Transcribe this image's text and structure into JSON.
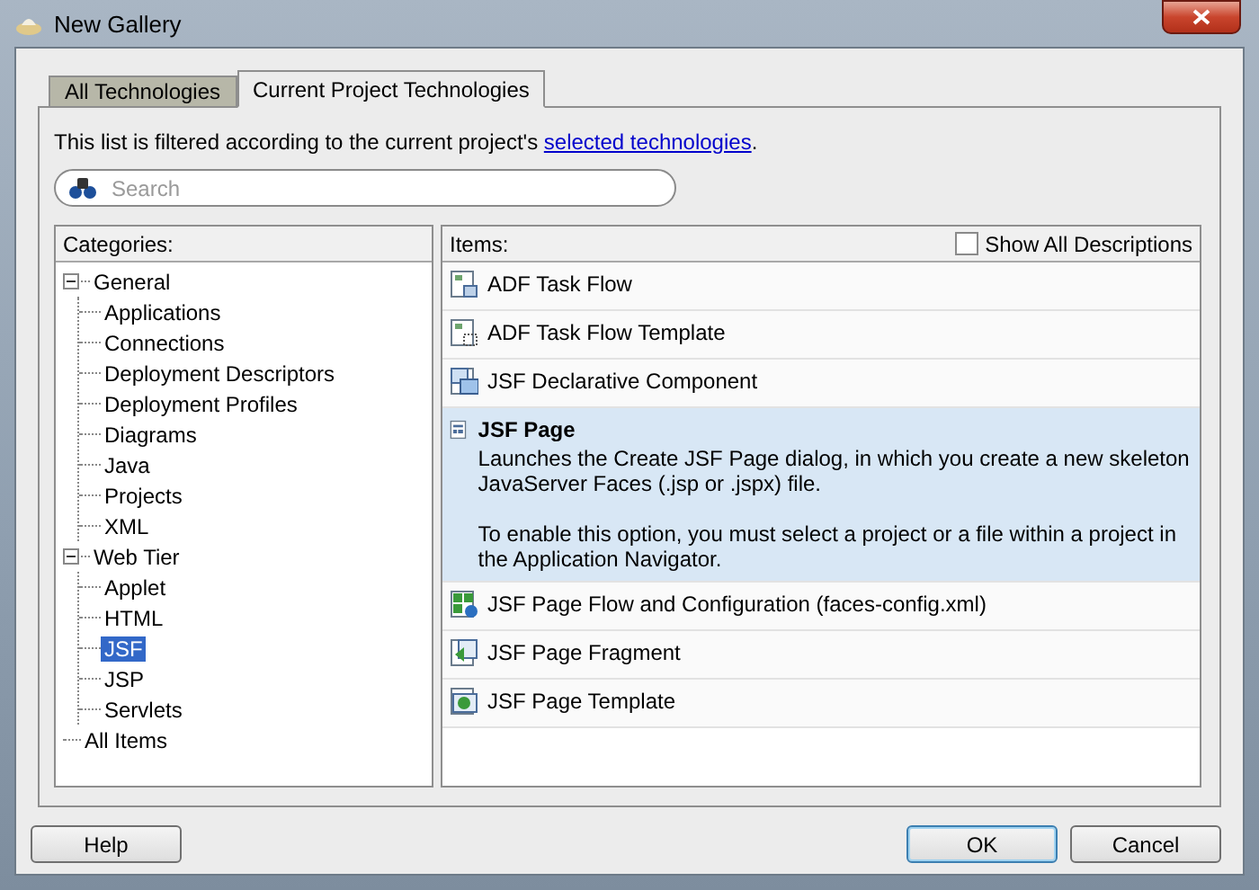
{
  "window": {
    "title": "New Gallery"
  },
  "tabs": [
    {
      "label": "All Technologies",
      "selected": false
    },
    {
      "label": "Current Project Technologies",
      "selected": true
    }
  ],
  "filter_note": {
    "text": "This list is filtered according to the current project's ",
    "link": "selected technologies",
    "end": "."
  },
  "search": {
    "placeholder": "Search"
  },
  "categories": {
    "label": "Categories:",
    "tree": [
      {
        "label": "General",
        "expanded": true,
        "selected": false,
        "children": [
          {
            "label": "Applications",
            "selected": false
          },
          {
            "label": "Connections",
            "selected": false
          },
          {
            "label": "Deployment Descriptors",
            "selected": false
          },
          {
            "label": "Deployment Profiles",
            "selected": false
          },
          {
            "label": "Diagrams",
            "selected": false
          },
          {
            "label": "Java",
            "selected": false
          },
          {
            "label": "Projects",
            "selected": false
          },
          {
            "label": "XML",
            "selected": false
          }
        ]
      },
      {
        "label": "Web Tier",
        "expanded": true,
        "selected": false,
        "children": [
          {
            "label": "Applet",
            "selected": false
          },
          {
            "label": "HTML",
            "selected": false
          },
          {
            "label": "JSF",
            "selected": true
          },
          {
            "label": "JSP",
            "selected": false
          },
          {
            "label": "Servlets",
            "selected": false
          }
        ]
      },
      {
        "label": "All Items",
        "selected": false
      }
    ]
  },
  "items": {
    "label": "Items:",
    "show_all_descriptions": {
      "label": "Show All Descriptions",
      "checked": false
    },
    "list": [
      {
        "kind": "taskflow",
        "label": "ADF Task Flow",
        "selected": false
      },
      {
        "kind": "template",
        "label": "ADF Task Flow Template",
        "selected": false
      },
      {
        "kind": "component",
        "label": "JSF Declarative Component",
        "selected": false
      },
      {
        "kind": "page",
        "label": "JSF Page",
        "selected": true,
        "description": [
          "Launches the Create JSF Page dialog, in which you create a new skeleton JavaServer Faces (.jsp or .jspx) file.",
          "To enable this option, you must select a project or a file within a project in the Application Navigator."
        ]
      },
      {
        "kind": "flow",
        "label": "JSF Page Flow and Configuration (faces-config.xml)",
        "selected": false
      },
      {
        "kind": "fragment",
        "label": "JSF Page Fragment",
        "selected": false
      },
      {
        "kind": "pagetemplate",
        "label": "JSF Page Template",
        "selected": false
      }
    ]
  },
  "buttons": {
    "left": [
      "Help"
    ],
    "right": [
      {
        "label": "OK",
        "default": true
      },
      {
        "label": "Cancel",
        "default": false
      }
    ]
  }
}
